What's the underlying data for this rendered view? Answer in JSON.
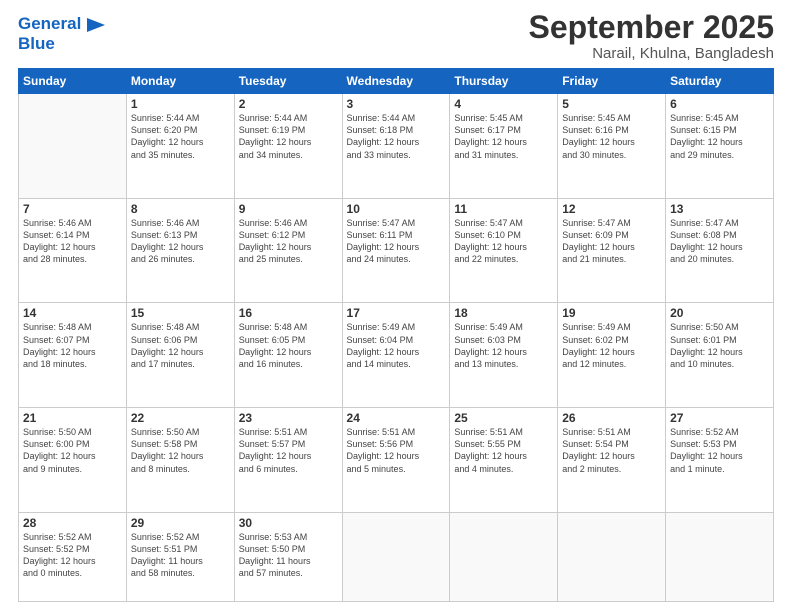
{
  "header": {
    "logo_line1": "General",
    "logo_line2": "Blue",
    "month": "September 2025",
    "location": "Narail, Khulna, Bangladesh"
  },
  "weekdays": [
    "Sunday",
    "Monday",
    "Tuesday",
    "Wednesday",
    "Thursday",
    "Friday",
    "Saturday"
  ],
  "weeks": [
    [
      {
        "day": "",
        "info": ""
      },
      {
        "day": "1",
        "info": "Sunrise: 5:44 AM\nSunset: 6:20 PM\nDaylight: 12 hours\nand 35 minutes."
      },
      {
        "day": "2",
        "info": "Sunrise: 5:44 AM\nSunset: 6:19 PM\nDaylight: 12 hours\nand 34 minutes."
      },
      {
        "day": "3",
        "info": "Sunrise: 5:44 AM\nSunset: 6:18 PM\nDaylight: 12 hours\nand 33 minutes."
      },
      {
        "day": "4",
        "info": "Sunrise: 5:45 AM\nSunset: 6:17 PM\nDaylight: 12 hours\nand 31 minutes."
      },
      {
        "day": "5",
        "info": "Sunrise: 5:45 AM\nSunset: 6:16 PM\nDaylight: 12 hours\nand 30 minutes."
      },
      {
        "day": "6",
        "info": "Sunrise: 5:45 AM\nSunset: 6:15 PM\nDaylight: 12 hours\nand 29 minutes."
      }
    ],
    [
      {
        "day": "7",
        "info": "Sunrise: 5:46 AM\nSunset: 6:14 PM\nDaylight: 12 hours\nand 28 minutes."
      },
      {
        "day": "8",
        "info": "Sunrise: 5:46 AM\nSunset: 6:13 PM\nDaylight: 12 hours\nand 26 minutes."
      },
      {
        "day": "9",
        "info": "Sunrise: 5:46 AM\nSunset: 6:12 PM\nDaylight: 12 hours\nand 25 minutes."
      },
      {
        "day": "10",
        "info": "Sunrise: 5:47 AM\nSunset: 6:11 PM\nDaylight: 12 hours\nand 24 minutes."
      },
      {
        "day": "11",
        "info": "Sunrise: 5:47 AM\nSunset: 6:10 PM\nDaylight: 12 hours\nand 22 minutes."
      },
      {
        "day": "12",
        "info": "Sunrise: 5:47 AM\nSunset: 6:09 PM\nDaylight: 12 hours\nand 21 minutes."
      },
      {
        "day": "13",
        "info": "Sunrise: 5:47 AM\nSunset: 6:08 PM\nDaylight: 12 hours\nand 20 minutes."
      }
    ],
    [
      {
        "day": "14",
        "info": "Sunrise: 5:48 AM\nSunset: 6:07 PM\nDaylight: 12 hours\nand 18 minutes."
      },
      {
        "day": "15",
        "info": "Sunrise: 5:48 AM\nSunset: 6:06 PM\nDaylight: 12 hours\nand 17 minutes."
      },
      {
        "day": "16",
        "info": "Sunrise: 5:48 AM\nSunset: 6:05 PM\nDaylight: 12 hours\nand 16 minutes."
      },
      {
        "day": "17",
        "info": "Sunrise: 5:49 AM\nSunset: 6:04 PM\nDaylight: 12 hours\nand 14 minutes."
      },
      {
        "day": "18",
        "info": "Sunrise: 5:49 AM\nSunset: 6:03 PM\nDaylight: 12 hours\nand 13 minutes."
      },
      {
        "day": "19",
        "info": "Sunrise: 5:49 AM\nSunset: 6:02 PM\nDaylight: 12 hours\nand 12 minutes."
      },
      {
        "day": "20",
        "info": "Sunrise: 5:50 AM\nSunset: 6:01 PM\nDaylight: 12 hours\nand 10 minutes."
      }
    ],
    [
      {
        "day": "21",
        "info": "Sunrise: 5:50 AM\nSunset: 6:00 PM\nDaylight: 12 hours\nand 9 minutes."
      },
      {
        "day": "22",
        "info": "Sunrise: 5:50 AM\nSunset: 5:58 PM\nDaylight: 12 hours\nand 8 minutes."
      },
      {
        "day": "23",
        "info": "Sunrise: 5:51 AM\nSunset: 5:57 PM\nDaylight: 12 hours\nand 6 minutes."
      },
      {
        "day": "24",
        "info": "Sunrise: 5:51 AM\nSunset: 5:56 PM\nDaylight: 12 hours\nand 5 minutes."
      },
      {
        "day": "25",
        "info": "Sunrise: 5:51 AM\nSunset: 5:55 PM\nDaylight: 12 hours\nand 4 minutes."
      },
      {
        "day": "26",
        "info": "Sunrise: 5:51 AM\nSunset: 5:54 PM\nDaylight: 12 hours\nand 2 minutes."
      },
      {
        "day": "27",
        "info": "Sunrise: 5:52 AM\nSunset: 5:53 PM\nDaylight: 12 hours\nand 1 minute."
      }
    ],
    [
      {
        "day": "28",
        "info": "Sunrise: 5:52 AM\nSunset: 5:52 PM\nDaylight: 12 hours\nand 0 minutes."
      },
      {
        "day": "29",
        "info": "Sunrise: 5:52 AM\nSunset: 5:51 PM\nDaylight: 11 hours\nand 58 minutes."
      },
      {
        "day": "30",
        "info": "Sunrise: 5:53 AM\nSunset: 5:50 PM\nDaylight: 11 hours\nand 57 minutes."
      },
      {
        "day": "",
        "info": ""
      },
      {
        "day": "",
        "info": ""
      },
      {
        "day": "",
        "info": ""
      },
      {
        "day": "",
        "info": ""
      }
    ]
  ]
}
